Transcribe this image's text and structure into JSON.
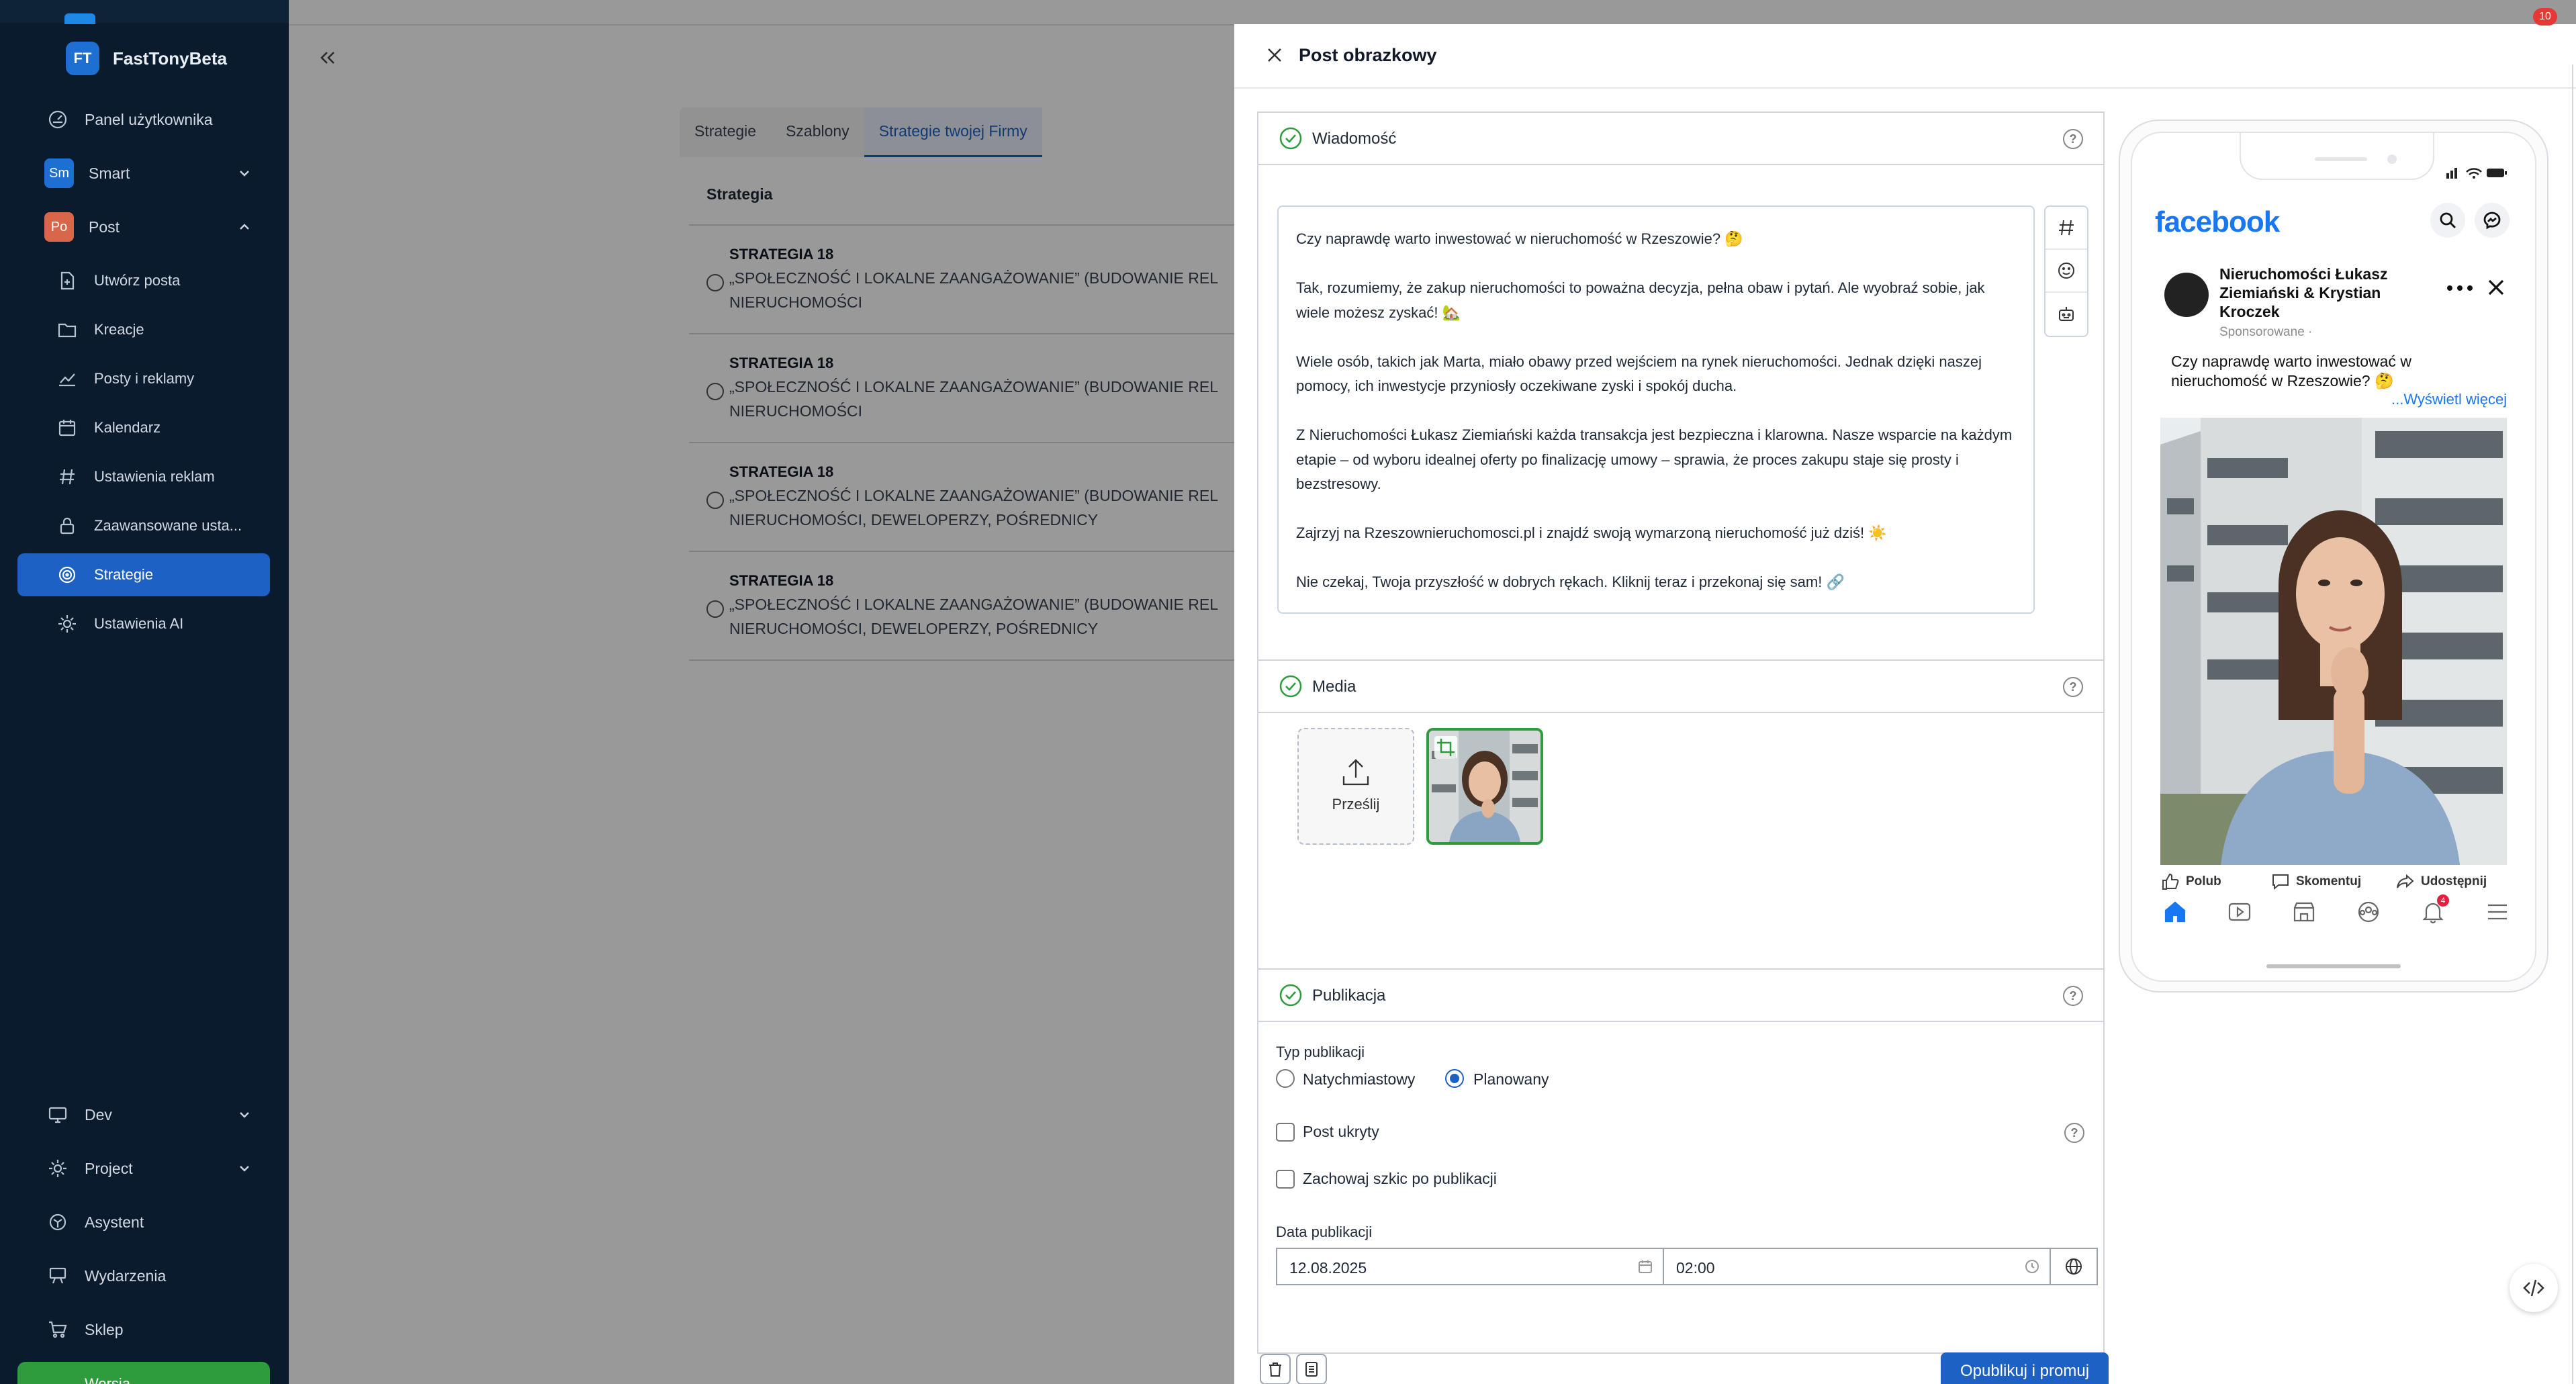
{
  "brand": {
    "logo_text": "FT",
    "name": "FastTonyBeta"
  },
  "sidebar": {
    "items": [
      {
        "label": "Panel użytkownika"
      },
      {
        "label": "Smart",
        "badge": "Sm",
        "badge_color": "#1d6fd1"
      },
      {
        "label": "Post",
        "badge": "Po",
        "badge_color": "#d9654a"
      },
      {
        "label": "Utwórz posta"
      },
      {
        "label": "Kreacje"
      },
      {
        "label": "Posty i reklamy"
      },
      {
        "label": "Kalendarz"
      },
      {
        "label": "Ustawienia reklam"
      },
      {
        "label": "Zaawansowane usta..."
      },
      {
        "label": "Strategie"
      },
      {
        "label": "Ustawienia AI"
      },
      {
        "label": "Dev"
      },
      {
        "label": "Project"
      },
      {
        "label": "Asystent"
      },
      {
        "label": "Wydarzenia"
      },
      {
        "label": "Sklep"
      }
    ],
    "bottom_button": "Wersja..."
  },
  "background_page": {
    "tabs": [
      "Strategie",
      "Szablony",
      "Strategie twojej Firmy"
    ],
    "table_header": "Strategia",
    "rows": [
      {
        "title": "STRATEGIA 18",
        "desc": "„SPOŁECZNOŚĆ I LOKALNE ZAANGAŻOWANIE” (BUDOWANIE REL\nNIERUCHOMOŚCI"
      },
      {
        "title": "STRATEGIA 18",
        "desc": "„SPOŁECZNOŚĆ I LOKALNE ZAANGAŻOWANIE” (BUDOWANIE REL\nNIERUCHOMOŚCI"
      },
      {
        "title": "STRATEGIA 18",
        "desc": "„SPOŁECZNOŚĆ I LOKALNE ZAANGAŻOWANIE” (BUDOWANIE REL\nNIERUCHOMOŚCI, DEWELOPERZY, POŚREDNICY"
      },
      {
        "title": "STRATEGIA 18",
        "desc": "„SPOŁECZNOŚĆ I LOKALNE ZAANGAŻOWANIE” (BUDOWANIE REL\nNIERUCHOMOŚCI, DEWELOPERZY, POŚREDNICY"
      }
    ]
  },
  "drawer": {
    "title": "Post obrazkowy",
    "message": {
      "section_title": "Wiadomość",
      "paragraphs": [
        "Czy naprawdę warto inwestować w nieruchomość w Rzeszowie? 🤔",
        "Tak, rozumiemy, że zakup nieruchomości to poważna decyzja, pełna obaw i pytań. Ale wyobraź sobie, jak wiele możesz zyskać! 🏡",
        "Wiele osób, takich jak Marta, miało obawy przed wejściem na rynek nieruchomości. Jednak dzięki naszej pomocy, ich inwestycje przyniosły oczekiwane zyski i spokój ducha.",
        "Z Nieruchomości Łukasz Ziemiański każda transakcja jest bezpieczna i klarowna. Nasze wsparcie na każdym etapie – od wyboru idealnej oferty po finalizację umowy – sprawia, że proces zakupu staje się prosty i bezstresowy.",
        "Zajrzyj na Rzeszownieruchomosci.pl i znajdź swoją wymarzoną nieruchomość już dziś! ☀️",
        "Nie czekaj, Twoja przyszłość w dobrych rękach. Kliknij teraz i przekonaj się sam! 🔗"
      ]
    },
    "media": {
      "section_title": "Media",
      "upload_label": "Prześlij"
    },
    "publication": {
      "section_title": "Publikacja",
      "type_label": "Typ publikacji",
      "option_immediate": "Natychmiastowy",
      "option_scheduled": "Planowany",
      "selected": "Planowany",
      "hidden_post_label": "Post ukryty",
      "keep_draft_label": "Zachowaj szkic po publikacji",
      "date_label": "Data publikacji",
      "date_value": "12.08.2025",
      "time_value": "02:00"
    },
    "publish_button": "Opublikuj i promuj"
  },
  "preview": {
    "network": "facebook",
    "page_name": "Nieruchomości Łukasz Ziemiański & Krystian Kroczek",
    "sponsored": "Sponsorowane ·",
    "post_text": "Czy naprawdę warto inwestować w nieruchomość w Rzeszowie? 🤔",
    "see_more": "...Wyświetl więcej",
    "actions": [
      "Polub",
      "Skomentuj",
      "Udostępnij"
    ],
    "notification_count": "4"
  },
  "top_badge": "10",
  "colors": {
    "sidebar_bg": "#0b1b2e",
    "accent": "#1d61c4",
    "success": "#2e9b3d",
    "facebook": "#1877f2"
  }
}
